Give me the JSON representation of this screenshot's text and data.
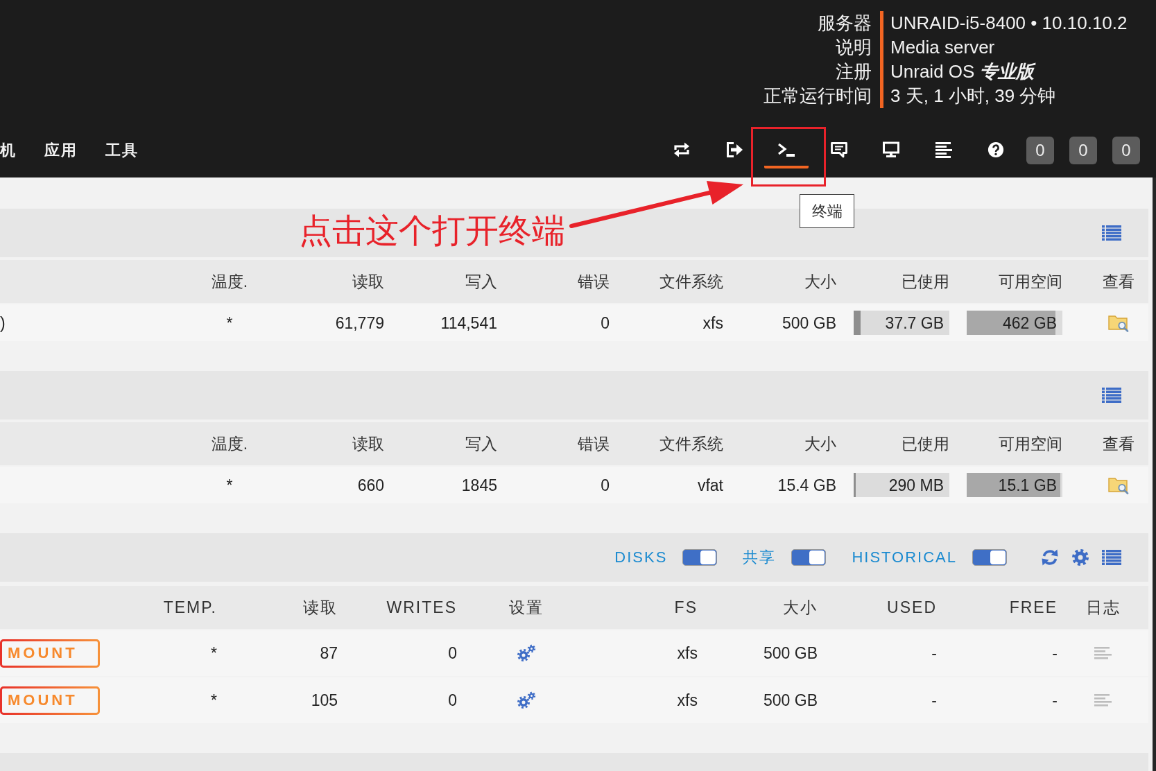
{
  "header": {
    "server_info": [
      {
        "label": "服务器",
        "value": "UNRAID-i5-8400 • 10.10.10.2"
      },
      {
        "label": "说明",
        "value": "Media server"
      },
      {
        "label": "注册",
        "value": "Unraid OS **专业版**"
      },
      {
        "label": "正常运行时间",
        "value": "3 天, 1 小时, 39 分钟"
      }
    ]
  },
  "nav": {
    "menu": [
      "机",
      "应用",
      "工具"
    ],
    "toolbar": [
      {
        "kind": "switch",
        "selected": false
      },
      {
        "kind": "logout",
        "selected": false
      },
      {
        "kind": "terminal",
        "selected": true
      },
      {
        "kind": "feedback",
        "selected": false
      },
      {
        "kind": "display",
        "selected": false
      },
      {
        "kind": "log",
        "selected": false
      },
      {
        "kind": "help",
        "selected": false
      }
    ],
    "counters": [
      "0",
      "0",
      "0"
    ],
    "tooltip": "终端"
  },
  "annotation": {
    "text": "点击这个打开终端"
  },
  "pools": [
    {
      "columns": [
        "温度.",
        "读取",
        "写入",
        "错误",
        "文件系统",
        "大小",
        "已使用",
        "可用空间",
        "查看"
      ],
      "rows": [
        {
          "column_1": ")",
          "temp": "*",
          "reads": "61,779",
          "writes": "114,541",
          "errors": "0",
          "fs": "xfs",
          "size": "500 GB",
          "used": {
            "text": "37.7 GB",
            "level": 0.075
          },
          "free": {
            "text": "462 GB",
            "level": 0.924
          }
        }
      ]
    },
    {
      "columns": [
        "温度.",
        "读取",
        "写入",
        "错误",
        "文件系统",
        "大小",
        "已使用",
        "可用空间",
        "查看"
      ],
      "rows": [
        {
          "temp": "*",
          "reads": "660",
          "writes": "1845",
          "errors": "0",
          "fs": "vfat",
          "size": "15.4 GB",
          "used": {
            "text": "290 MB",
            "level": 0.02
          },
          "free": {
            "text": "15.1 GB",
            "level": 0.98
          }
        }
      ]
    }
  ],
  "unassigned": {
    "toggles": [
      {
        "label": "DISKS",
        "on": true
      },
      {
        "label": "共享",
        "on": true
      },
      {
        "label": "HISTORICAL",
        "on": true
      }
    ],
    "columns": [
      "TEMP.",
      "读取",
      "WRITES",
      "设置",
      "FS",
      "大小",
      "USED",
      "FREE",
      "日志"
    ],
    "rows": [
      {
        "action": "MOUNT",
        "temp": "*",
        "reads": "87",
        "writes": "0",
        "fs": "xfs",
        "size": "500 GB",
        "used": "-",
        "free": "-"
      },
      {
        "action": "MOUNT",
        "temp": "*",
        "reads": "105",
        "writes": "0",
        "fs": "xfs",
        "size": "500 GB",
        "used": "-",
        "free": "-"
      }
    ]
  }
}
